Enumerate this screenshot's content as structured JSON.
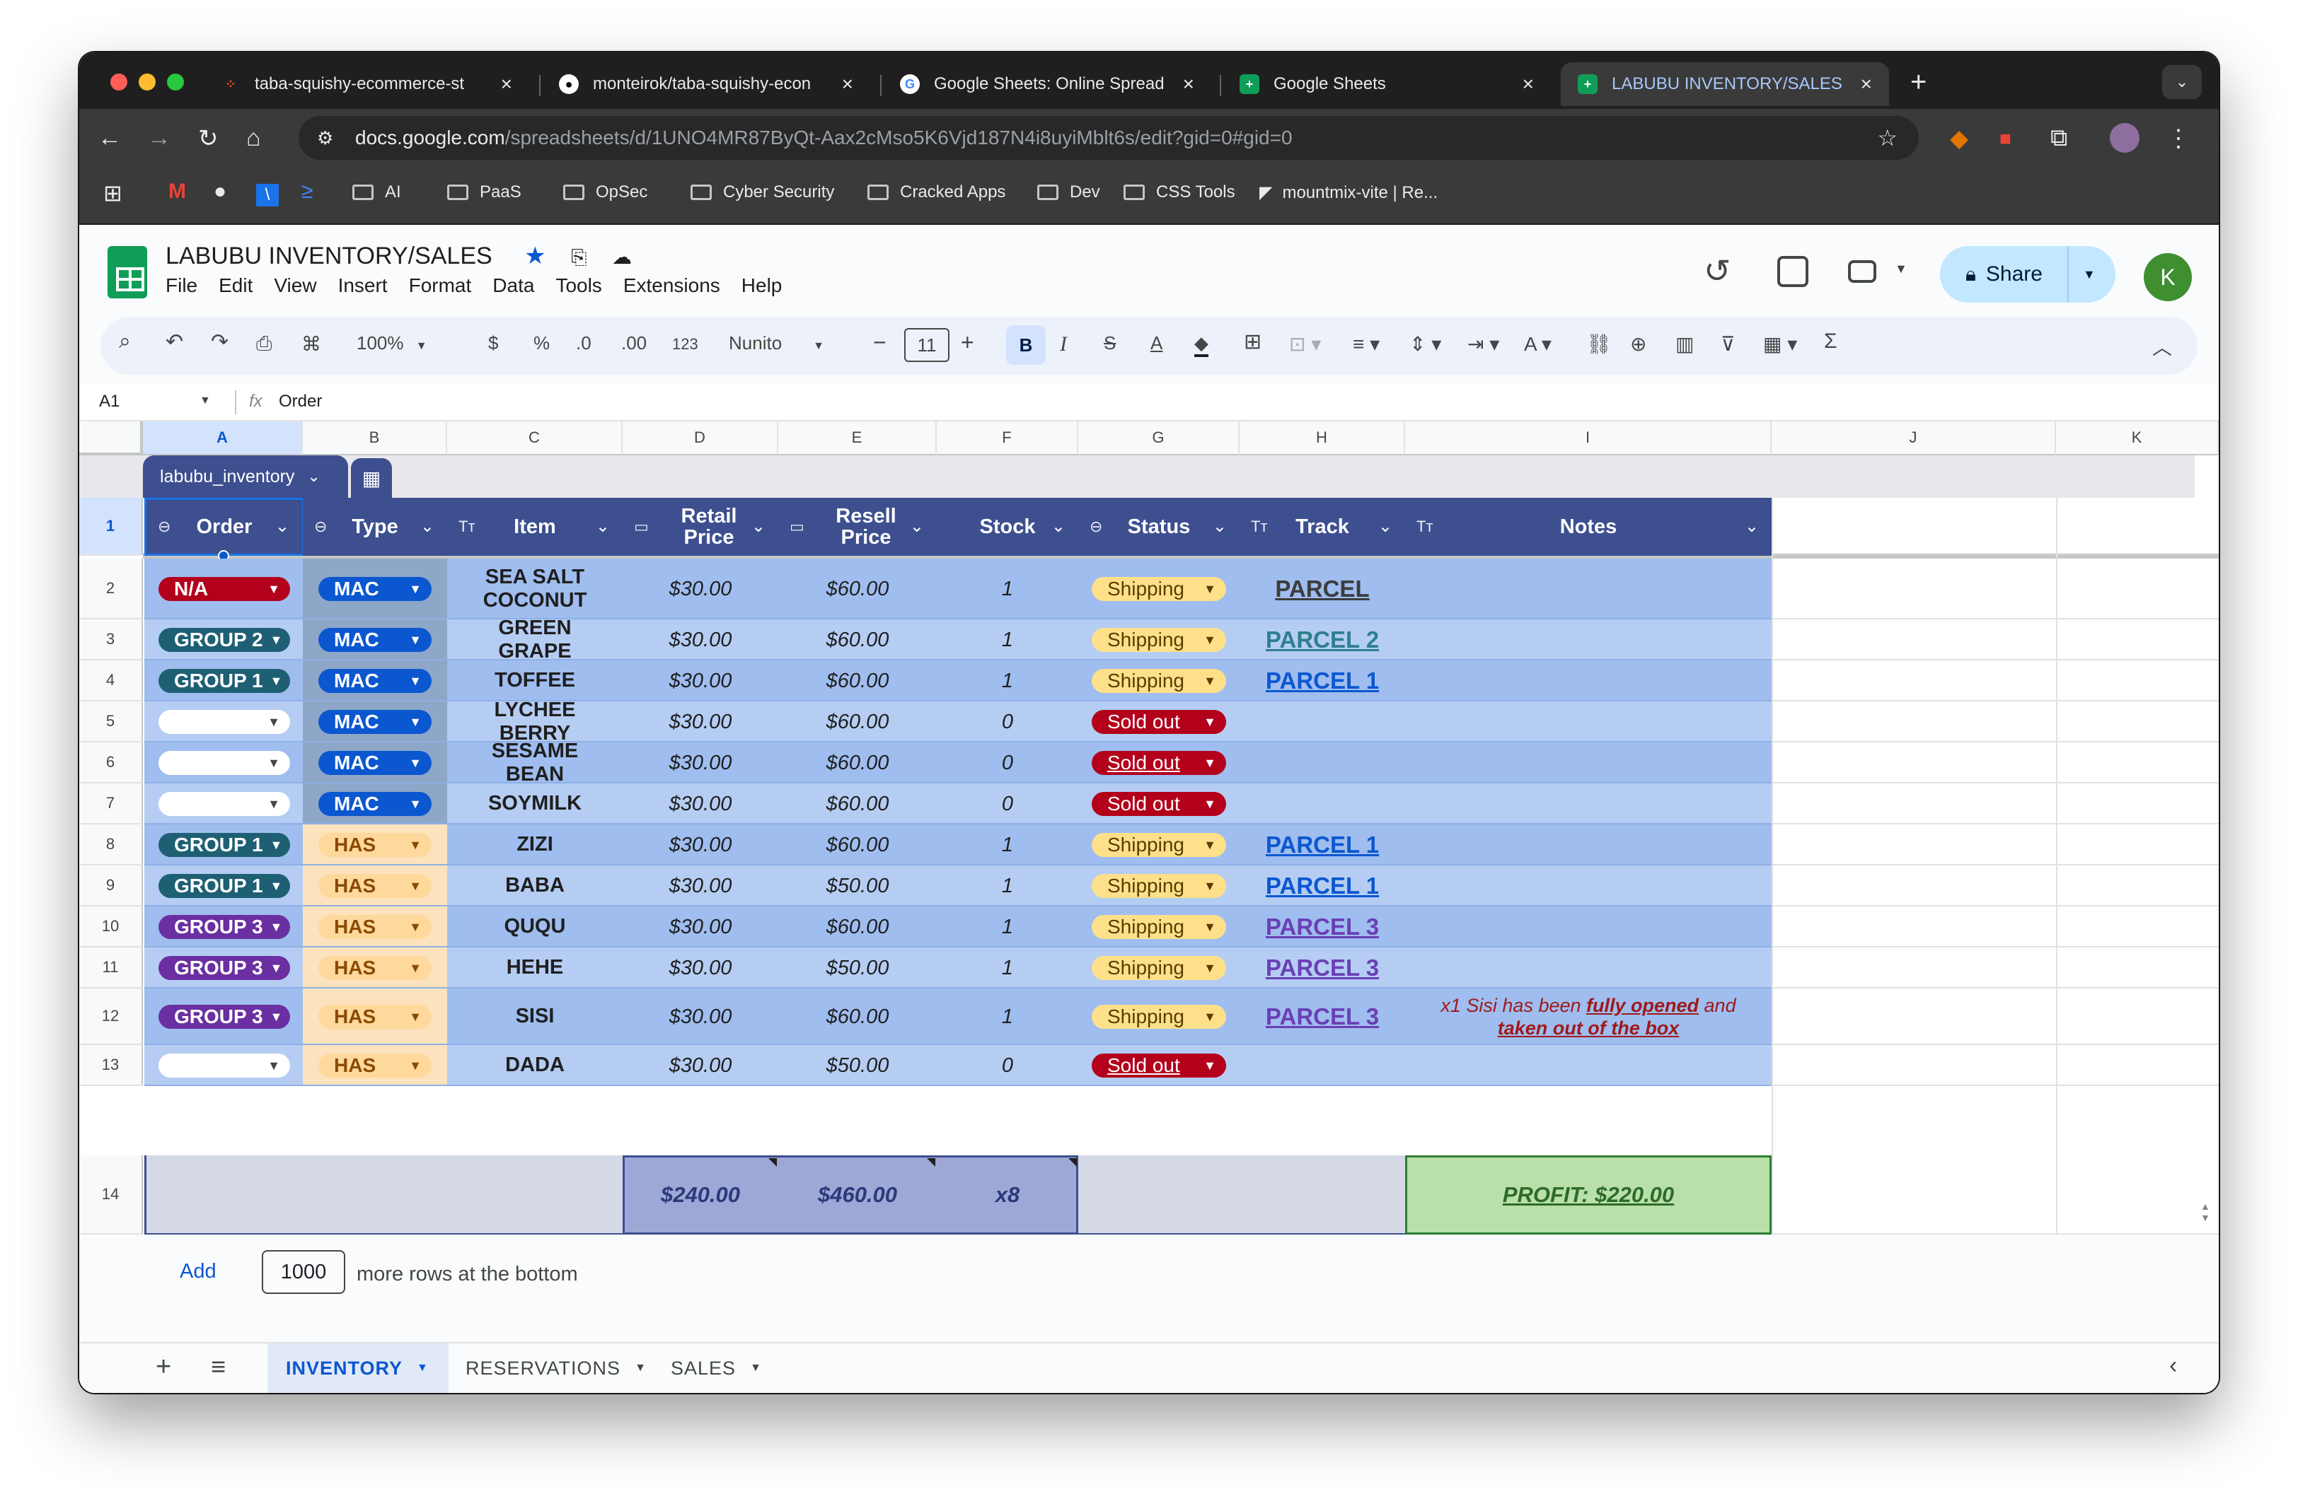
{
  "browser": {
    "tabs": [
      {
        "title": "taba-squishy-ecommerce-st",
        "icon": "figma-icon"
      },
      {
        "title": "monteirok/taba-squishy-econ",
        "icon": "github-icon"
      },
      {
        "title": "Google Sheets: Online Spread",
        "icon": "google-icon"
      },
      {
        "title": "Google Sheets",
        "icon": "sheets-icon"
      },
      {
        "title": "LABUBU INVENTORY/SALES",
        "icon": "sheets-icon"
      }
    ],
    "url_host": "docs.google.com",
    "url_path": "/spreadsheets/d/1UNO4MR87ByQt-Aax2cMso5K6Vjd187N4i8uyiMblt6s/edit?gid=0#gid=0",
    "bookmarks": [
      "AI",
      "PaaS",
      "OpSec",
      "Cyber Security",
      "Cracked Apps",
      "Dev",
      "CSS Tools",
      "mountmix-vite | Re..."
    ]
  },
  "sheets": {
    "doc_title": "LABUBU INVENTORY/SALES",
    "menus": [
      "File",
      "Edit",
      "View",
      "Insert",
      "Format",
      "Data",
      "Tools",
      "Extensions",
      "Help"
    ],
    "share_label": "Share",
    "avatar_letter": "K",
    "toolbar": {
      "zoom": "100%",
      "currency": "$",
      "percent": "%",
      "dec_less": ".0",
      "dec_more": ".00",
      "format_123": "123",
      "font": "Nunito",
      "font_size": "11",
      "bold": "B",
      "italic": "I",
      "strike": "S",
      "text_color": "A",
      "sigma": "Σ"
    },
    "name_box": "A1",
    "formula": "Order",
    "fx": "fx",
    "columns": [
      "A",
      "B",
      "C",
      "D",
      "E",
      "F",
      "G",
      "H",
      "I",
      "J",
      "K"
    ],
    "table_name": "labubu_inventory",
    "headers": {
      "order": "Order",
      "type": "Type",
      "item": "Item",
      "retail": "Retail Price",
      "resell": "Resell Price",
      "stock": "Stock",
      "status": "Status",
      "track": "Track",
      "notes": "Notes"
    },
    "rows": [
      {
        "n": "2",
        "order": "N/A",
        "type": "MAC",
        "item": "SEA SALT COCONUT",
        "retail": "$30.00",
        "resell": "$60.00",
        "stock": "1",
        "status": "Shipping",
        "track": "PARCEL"
      },
      {
        "n": "3",
        "order": "GROUP 2",
        "type": "MAC",
        "item": "GREEN GRAPE",
        "retail": "$30.00",
        "resell": "$60.00",
        "stock": "1",
        "status": "Shipping",
        "track": "PARCEL 2"
      },
      {
        "n": "4",
        "order": "GROUP 1",
        "type": "MAC",
        "item": "TOFFEE",
        "retail": "$30.00",
        "resell": "$60.00",
        "stock": "1",
        "status": "Shipping",
        "track": "PARCEL 1"
      },
      {
        "n": "5",
        "order": "",
        "type": "MAC",
        "item": "LYCHEE BERRY",
        "retail": "$30.00",
        "resell": "$60.00",
        "stock": "0",
        "status": "Sold out",
        "track": ""
      },
      {
        "n": "6",
        "order": "",
        "type": "MAC",
        "item": "SESAME BEAN",
        "retail": "$30.00",
        "resell": "$60.00",
        "stock": "0",
        "status": "Sold out",
        "track": ""
      },
      {
        "n": "7",
        "order": "",
        "type": "MAC",
        "item": "SOYMILK",
        "retail": "$30.00",
        "resell": "$60.00",
        "stock": "0",
        "status": "Sold out",
        "track": ""
      },
      {
        "n": "8",
        "order": "GROUP 1",
        "type": "HAS",
        "item": "ZIZI",
        "retail": "$30.00",
        "resell": "$60.00",
        "stock": "1",
        "status": "Shipping",
        "track": "PARCEL 1"
      },
      {
        "n": "9",
        "order": "GROUP 1",
        "type": "HAS",
        "item": "BABA",
        "retail": "$30.00",
        "resell": "$50.00",
        "stock": "1",
        "status": "Shipping",
        "track": "PARCEL 1"
      },
      {
        "n": "10",
        "order": "GROUP 3",
        "type": "HAS",
        "item": "QUQU",
        "retail": "$30.00",
        "resell": "$60.00",
        "stock": "1",
        "status": "Shipping",
        "track": "PARCEL 3"
      },
      {
        "n": "11",
        "order": "GROUP 3",
        "type": "HAS",
        "item": "HEHE",
        "retail": "$30.00",
        "resell": "$50.00",
        "stock": "1",
        "status": "Shipping",
        "track": "PARCEL 3"
      },
      {
        "n": "12",
        "order": "GROUP 3",
        "type": "HAS",
        "item": "SISI",
        "retail": "$30.00",
        "resell": "$60.00",
        "stock": "1",
        "status": "Shipping",
        "track": "PARCEL 3"
      },
      {
        "n": "13",
        "order": "",
        "type": "HAS",
        "item": "DADA",
        "retail": "$30.00",
        "resell": "$50.00",
        "stock": "0",
        "status": "Sold out",
        "track": ""
      }
    ],
    "note_row12": {
      "pre": "x1 Sisi has been ",
      "em1": "fully opened",
      "mid": " and",
      "em2": "taken out of the box"
    },
    "totals": {
      "n": "14",
      "retail": "$240.00",
      "resell": "$460.00",
      "stock": "x8",
      "profit": "PROFIT: $220.00"
    },
    "add_rows": {
      "button": "Add",
      "count": "1000",
      "label": "more rows at the bottom"
    },
    "sheet_tabs": [
      "INVENTORY",
      "RESERVATIONS",
      "SALES"
    ],
    "colors": {
      "header_bg": "#3d4f8f",
      "row_light": "#b5cdf3",
      "row_dark": "#9fbdef",
      "na_chip": "#b3001b",
      "group1_chip": "#1e5f74",
      "group2_chip": "#1e5f74",
      "group3_chip": "#6a2fa0",
      "mac_chip": "#0b57d0",
      "has_chip": "#ffd89c",
      "shipping_chip": "#ffe08a",
      "soldout_chip": "#b3001b",
      "profit_bg": "#b8e0a8"
    }
  }
}
